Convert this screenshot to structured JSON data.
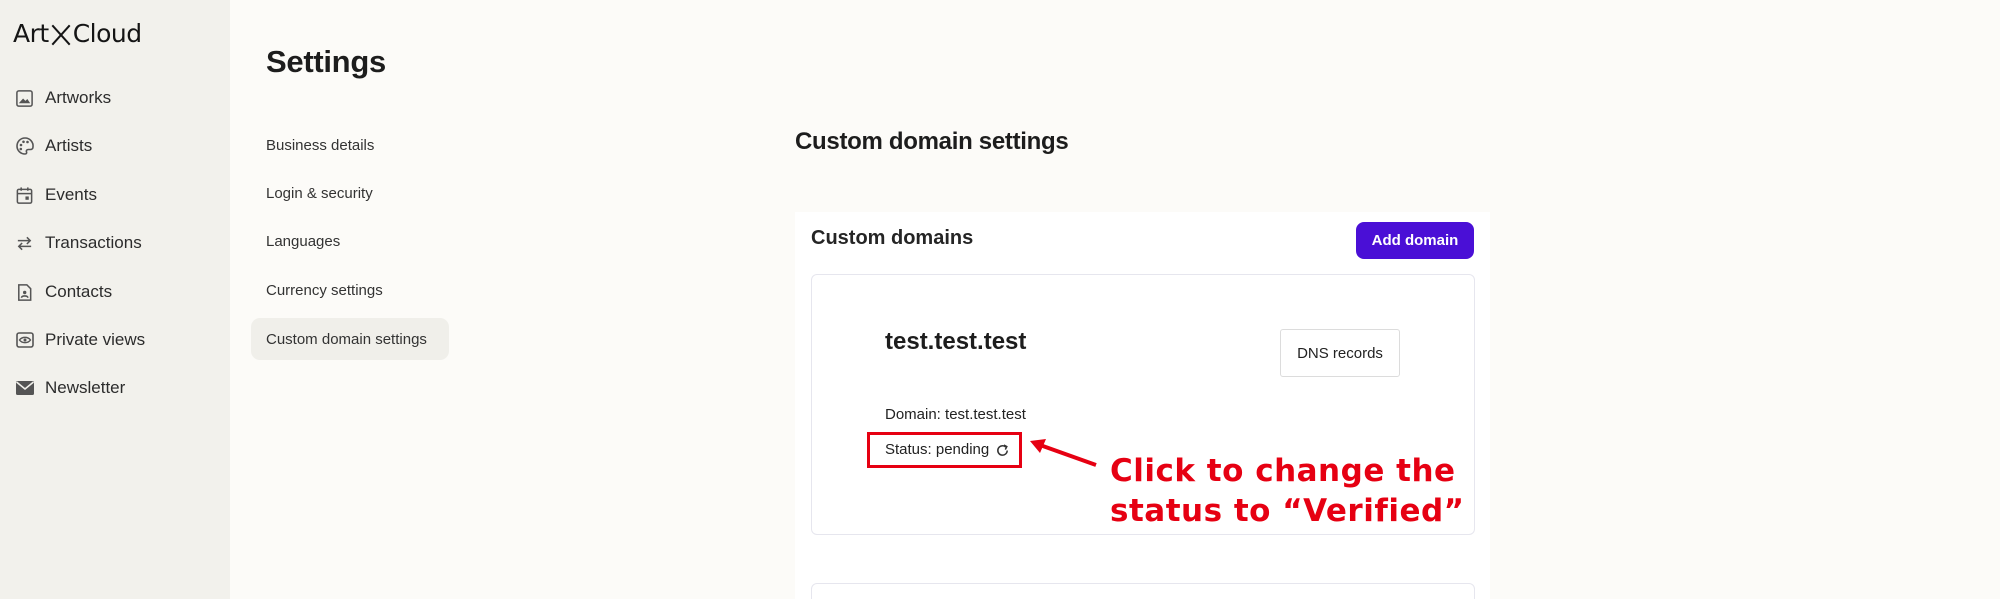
{
  "brand": {
    "logo_left": "Art",
    "logo_right": "Cloud"
  },
  "sidebar": {
    "items": [
      {
        "label": "Artworks",
        "icon": "image-icon"
      },
      {
        "label": "Artists",
        "icon": "palette-icon"
      },
      {
        "label": "Events",
        "icon": "calendar-icon"
      },
      {
        "label": "Transactions",
        "icon": "swap-arrows-icon"
      },
      {
        "label": "Contacts",
        "icon": "contact-file-icon"
      },
      {
        "label": "Private views",
        "icon": "eye-icon"
      },
      {
        "label": "Newsletter",
        "icon": "mail-icon"
      }
    ]
  },
  "page": {
    "title": "Settings"
  },
  "settings_nav": {
    "items": [
      {
        "label": "Business details"
      },
      {
        "label": "Login & security"
      },
      {
        "label": "Languages"
      },
      {
        "label": "Currency settings"
      },
      {
        "label": "Custom domain settings",
        "active": true
      }
    ]
  },
  "custom_domain": {
    "section_title": "Custom domain settings",
    "card_title": "Custom domains",
    "add_button": "Add domain",
    "domain": {
      "name": "test.test.test",
      "dns_button": "DNS records",
      "domain_line": "Domain: test.test.test",
      "status_line": "Status: pending"
    }
  },
  "annotation": {
    "line1": "Click to change the",
    "line2": "status to “Verified”",
    "color": "#e60012"
  },
  "colors": {
    "accent": "#4a0fd6",
    "sidebar_bg": "#f2f1ec",
    "page_bg": "#fcfbf8"
  }
}
